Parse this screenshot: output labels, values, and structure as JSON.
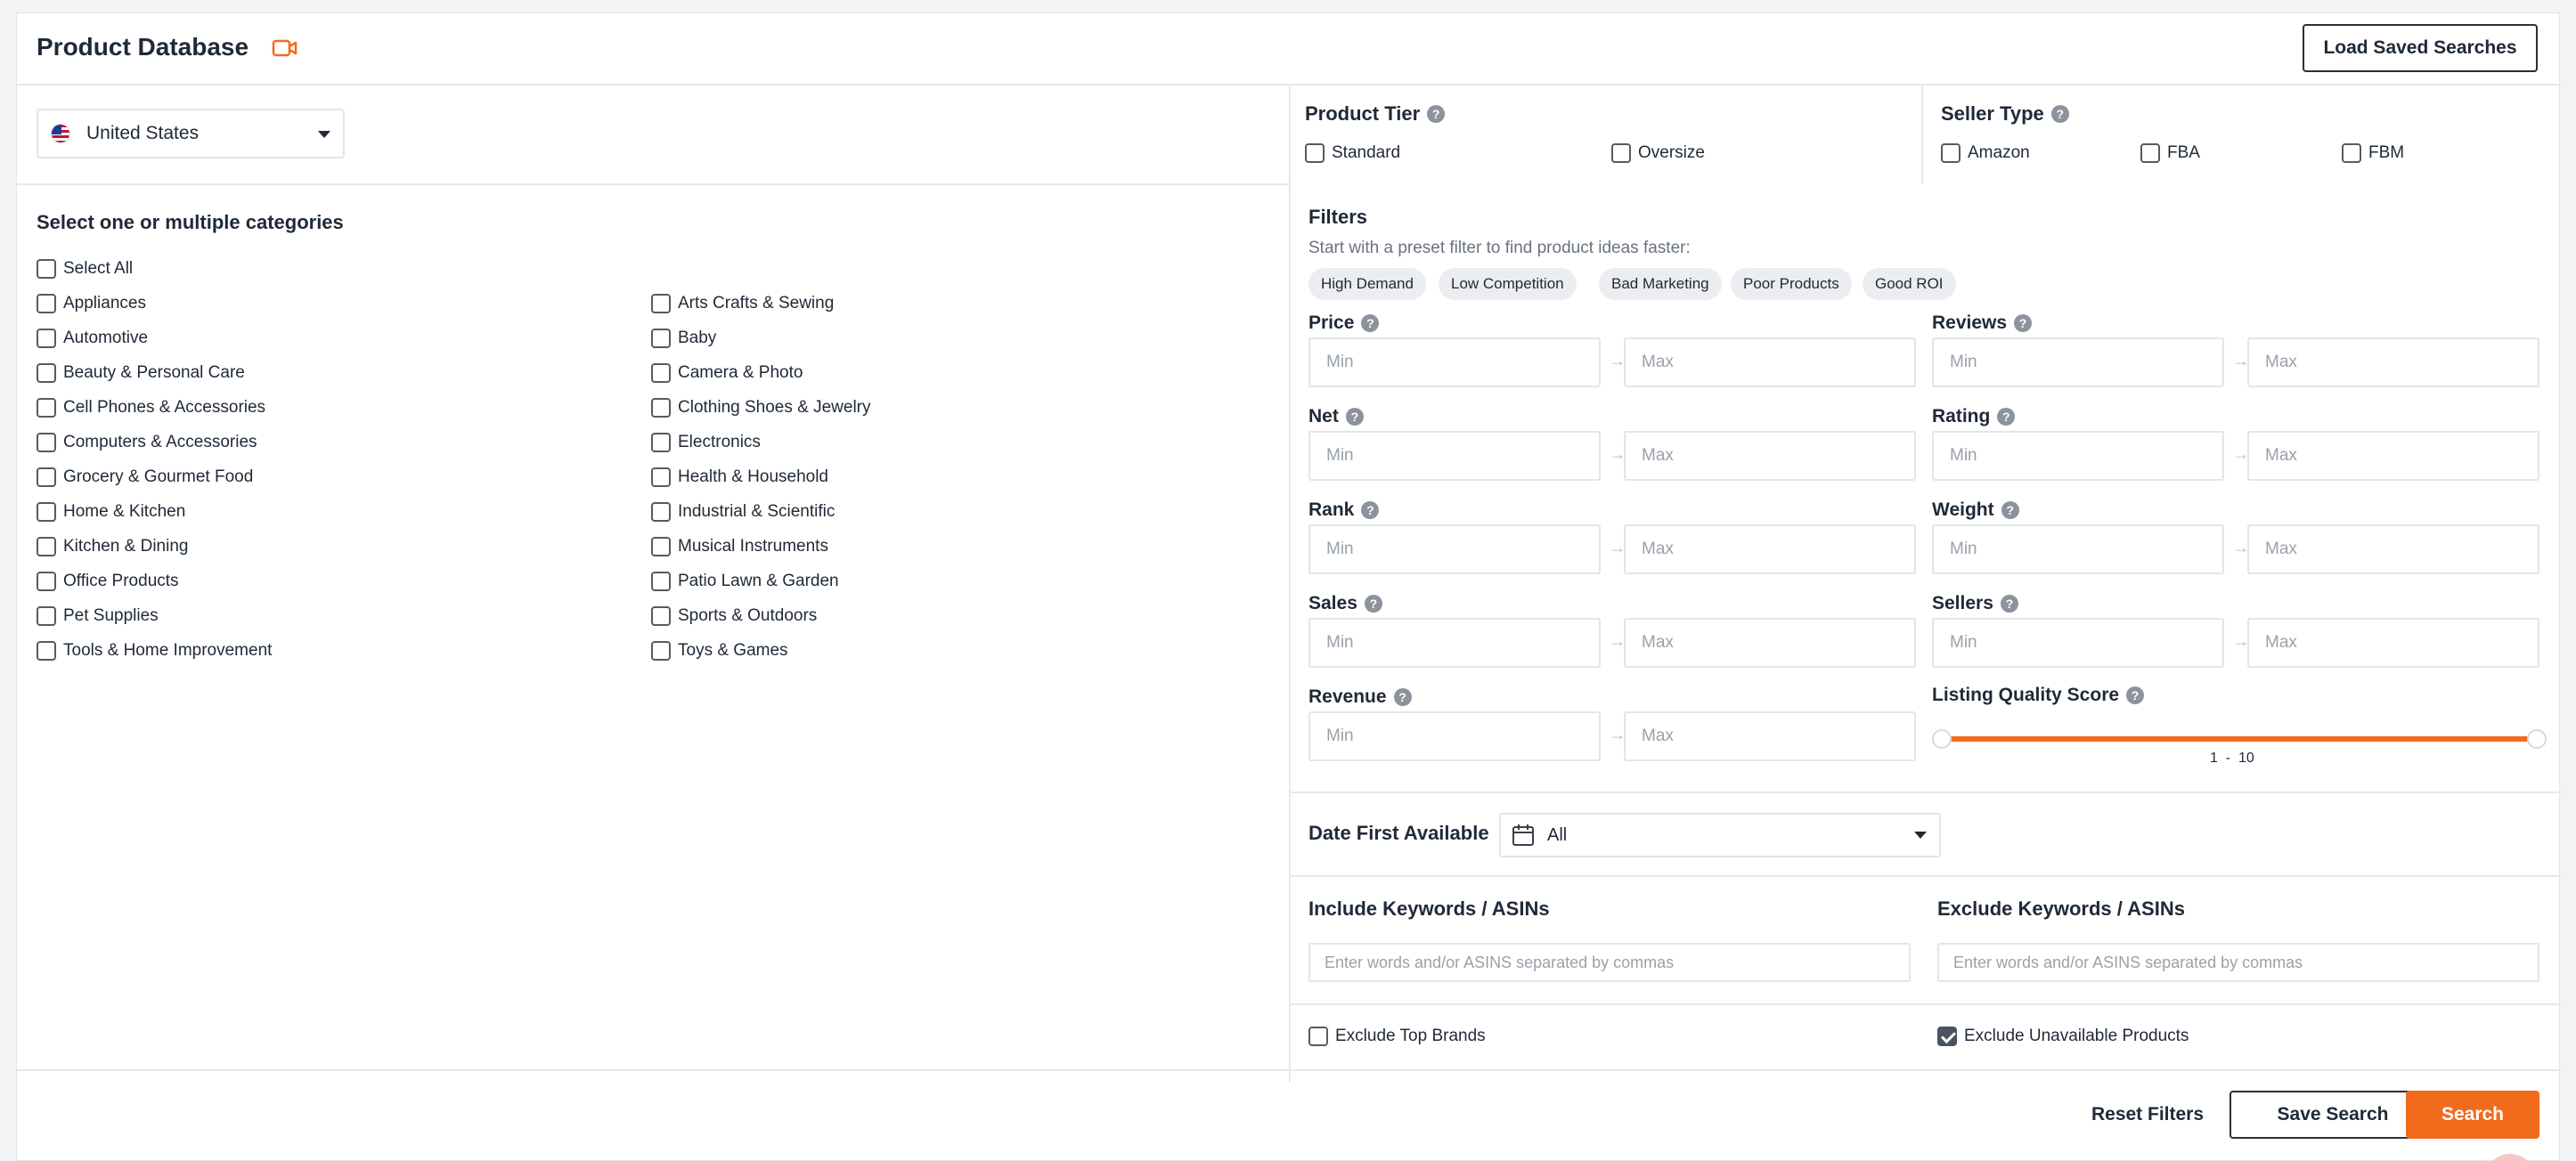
{
  "header": {
    "title": "Product Database",
    "load_saved_label": "Load Saved Searches"
  },
  "marketplace": {
    "selected": "United States"
  },
  "categories": {
    "title": "Select one or multiple categories",
    "select_all": "Select All",
    "left": [
      "Appliances",
      "Automotive",
      "Beauty & Personal Care",
      "Cell Phones & Accessories",
      "Computers & Accessories",
      "Grocery & Gourmet Food",
      "Home & Kitchen",
      "Kitchen & Dining",
      "Office Products",
      "Pet Supplies",
      "Tools & Home Improvement"
    ],
    "right": [
      "Arts Crafts & Sewing",
      "Baby",
      "Camera & Photo",
      "Clothing Shoes & Jewelry",
      "Electronics",
      "Health & Household",
      "Industrial & Scientific",
      "Musical Instruments",
      "Patio Lawn & Garden",
      "Sports & Outdoors",
      "Toys & Games"
    ]
  },
  "product_tier": {
    "label": "Product Tier",
    "options": [
      "Standard",
      "Oversize"
    ]
  },
  "seller_type": {
    "label": "Seller Type",
    "options": [
      "Amazon",
      "FBA",
      "FBM"
    ]
  },
  "filters": {
    "title": "Filters",
    "subtitle": "Start with a preset filter to find product ideas faster:",
    "presets": [
      "High Demand",
      "Low Competition",
      "Bad Marketing",
      "Poor Products",
      "Good ROI"
    ],
    "min_placeholder": "Min",
    "max_placeholder": "Max",
    "left_fields": [
      "Price",
      "Net",
      "Rank",
      "Sales",
      "Revenue"
    ],
    "right_fields": [
      "Reviews",
      "Rating",
      "Weight",
      "Sellers"
    ],
    "lqs": {
      "label": "Listing Quality Score",
      "min": "1",
      "sep": "-",
      "max": "10"
    }
  },
  "date_first_available": {
    "label": "Date First Available",
    "value": "All"
  },
  "keywords": {
    "include_label": "Include Keywords / ASINs",
    "exclude_label": "Exclude Keywords / ASINs",
    "placeholder": "Enter words and/or ASINS separated by commas"
  },
  "toggles": {
    "exclude_top_brands": {
      "label": "Exclude Top Brands",
      "checked": false
    },
    "exclude_unavailable": {
      "label": "Exclude Unavailable Products",
      "checked": true
    }
  },
  "actions": {
    "reset": "Reset Filters",
    "save": "Save Search",
    "search": "Search"
  },
  "colors": {
    "accent": "#f26b1d",
    "text": "#1f2937",
    "muted": "#6b7280",
    "border": "#e3e5e8"
  }
}
